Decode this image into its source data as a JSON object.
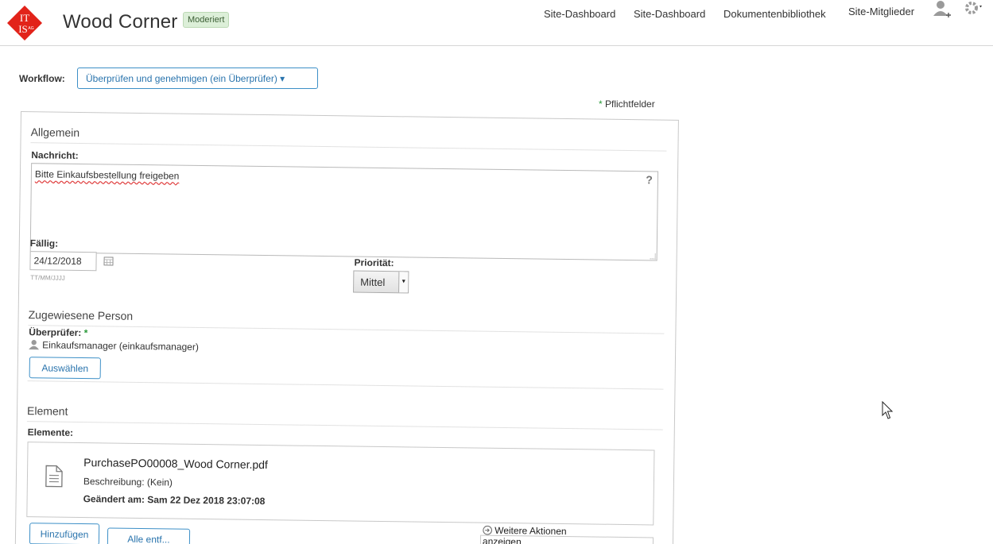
{
  "header": {
    "site_title": "Wood Corner",
    "badge": "Moderiert",
    "nav": [
      "Site-Dashboard",
      "Site-Dashboard",
      "Dokumentenbibliothek",
      "Site-Mitglieder"
    ],
    "logo_text_top": "IT",
    "logo_text_bottom": "IS",
    "logo_text_small": "AG",
    "accent_color": "#e2231a"
  },
  "workflow": {
    "label": "Workflow:",
    "selected": "Überprüfen und genehmigen (ein Überprüfer) ▾"
  },
  "required_note": "Pflichtfelder",
  "required_star": "*",
  "general": {
    "title": "Allgemein",
    "message_label": "Nachricht:",
    "message_value": "Bitte Einkaufsbestellung freigeben",
    "help_glyph": "?",
    "due_label": "Fällig:",
    "due_value": "24/12/2018",
    "due_hint": "TT/MM/JJJJ",
    "priority_label": "Priorität:",
    "priority_value": "Mittel"
  },
  "assignee": {
    "title": "Zugewiesene Person",
    "reviewer_label": "Überprüfer:",
    "reviewer_value": "Einkaufsmanager (einkaufsmanager)",
    "select_button": "Auswählen"
  },
  "element": {
    "title": "Element",
    "items_label": "Elemente:",
    "item": {
      "name": "PurchasePO00008_Wood Corner.pdf",
      "description": "Beschreibung: (Kein)",
      "modified": "Geändert am: Sam 22 Dez 2018 23:07:08"
    },
    "add_button": "Hinzufügen",
    "remove_all_button": "Alle entf...",
    "more_actions_line1": "Weitere Aktionen",
    "more_actions_line2": "anzeigen"
  }
}
